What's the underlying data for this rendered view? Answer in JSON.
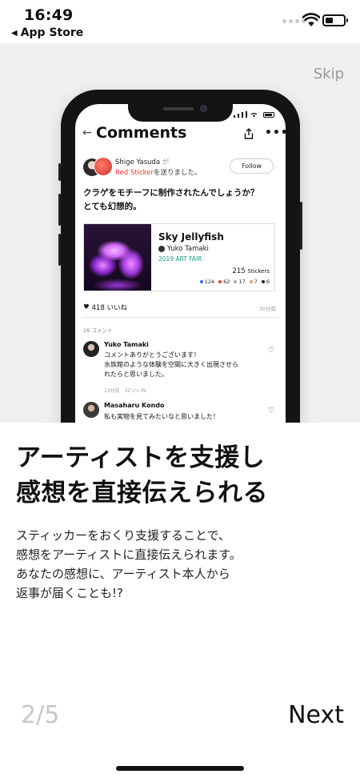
{
  "status_bar": {
    "time": "16:49",
    "back_label": "App Store",
    "back_arrow": "◀"
  },
  "onboarding": {
    "skip_label": "Skip",
    "headline_line1": "アーティストを支援し",
    "headline_line2": "感想を直接伝えられる",
    "desc_line1": "スティッカーをおくり支援することで、",
    "desc_line2": "感想をアーティストに直接伝えられます。",
    "desc_line3": "あなたの感想に、アーティスト本人から",
    "desc_line4": "返事が届くことも!?",
    "page_indicator": "2/5",
    "next_label": "Next"
  },
  "mock_screen": {
    "title": "Comments",
    "back_arrow": "←",
    "more": "•••",
    "post": {
      "user": "Shige Yasuda",
      "user_suffix": "が",
      "sticker_label": "Red Sticker",
      "action": "を送りました。",
      "follow_label": "Follow",
      "text_line1": "クラゲをモチーフに制作されたんでしょうか？",
      "text_line2": "とても幻想的。"
    },
    "artwork": {
      "title": "Sky Jellyfish",
      "artist": "Yuko Tamaki",
      "event": "2019 ART FAIR",
      "sticker_count": "215",
      "sticker_unit": "Stickers",
      "stats": [
        {
          "value": "124",
          "color": "#3b6fe0"
        },
        {
          "value": "62",
          "color": "#e23b35"
        },
        {
          "value": "17",
          "color": "#aaaaaa"
        },
        {
          "value": "7",
          "color": "#d8a35a"
        },
        {
          "value": "6",
          "color": "#222222"
        }
      ]
    },
    "likes": "418 いいね",
    "time_ago": "30分前",
    "comment_count": "28 コメント",
    "comments": [
      {
        "name": "Yuko Tamaki",
        "line1": "コメントありがとうございます！",
        "line2": "水族館のような体験を空間に大きく出現させら",
        "line3": "れたらと思いました。",
        "meta_time": "13分前",
        "meta_likes": "32 いいね"
      },
      {
        "name": "Masaharu Kondo",
        "line1": "私も実物を見てみたいなと思いました！"
      }
    ]
  }
}
